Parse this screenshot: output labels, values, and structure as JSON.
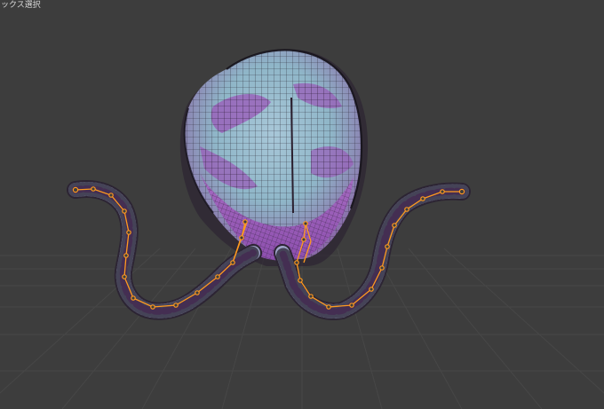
{
  "viewport": {
    "mode_label": "ックス選択",
    "background_color": "#3d3d3d",
    "grid_color": "#474747",
    "mesh_fill_light": "#8fb6c8",
    "mesh_fill_purple": "#9a58b8",
    "mesh_wire_color": "#1f1a26",
    "bone_color": "#ff9a1f"
  },
  "object": {
    "name": "",
    "icon": "hair-mesh-with-armature"
  }
}
